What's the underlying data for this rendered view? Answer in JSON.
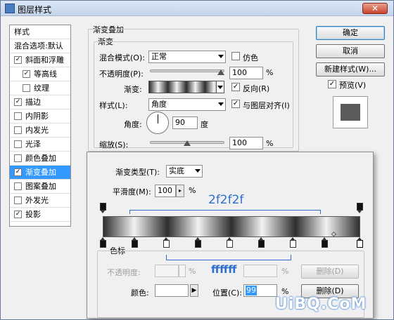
{
  "window": {
    "title": "图层样式",
    "close": "✕"
  },
  "left_panel": {
    "items": [
      {
        "label": "样式",
        "checkbox": false,
        "checked": false,
        "indent": 0,
        "selected": false
      },
      {
        "label": "混合选项:默认",
        "checkbox": false,
        "checked": false,
        "indent": 0,
        "selected": false
      },
      {
        "label": "斜面和浮雕",
        "checkbox": true,
        "checked": true,
        "indent": 0,
        "selected": false
      },
      {
        "label": "等高线",
        "checkbox": true,
        "checked": true,
        "indent": 1,
        "selected": false
      },
      {
        "label": "纹理",
        "checkbox": true,
        "checked": false,
        "indent": 1,
        "selected": false
      },
      {
        "label": "描边",
        "checkbox": true,
        "checked": true,
        "indent": 0,
        "selected": false
      },
      {
        "label": "内阴影",
        "checkbox": true,
        "checked": false,
        "indent": 0,
        "selected": false
      },
      {
        "label": "内发光",
        "checkbox": true,
        "checked": false,
        "indent": 0,
        "selected": false
      },
      {
        "label": "光泽",
        "checkbox": true,
        "checked": false,
        "indent": 0,
        "selected": false
      },
      {
        "label": "颜色叠加",
        "checkbox": true,
        "checked": false,
        "indent": 0,
        "selected": false
      },
      {
        "label": "渐变叠加",
        "checkbox": true,
        "checked": true,
        "indent": 0,
        "selected": true
      },
      {
        "label": "图案叠加",
        "checkbox": true,
        "checked": false,
        "indent": 0,
        "selected": false
      },
      {
        "label": "外发光",
        "checkbox": true,
        "checked": false,
        "indent": 0,
        "selected": false
      },
      {
        "label": "投影",
        "checkbox": true,
        "checked": true,
        "indent": 0,
        "selected": false
      }
    ]
  },
  "gradient_overlay": {
    "section_title": "渐变叠加",
    "sub_title": "渐变",
    "blend_mode_label": "混合模式(O):",
    "blend_mode_value": "正常",
    "dither_label": "仿色",
    "dither_checked": false,
    "opacity_label": "不透明度(P):",
    "opacity_value": "100",
    "opacity_unit": "%",
    "opacity_level": 1.0,
    "gradient_label": "渐变:",
    "reverse_label": "反向(R)",
    "reverse_checked": true,
    "style_label": "样式(L):",
    "style_value": "角度",
    "align_label": "与图层对齐(I)",
    "align_checked": true,
    "angle_label": "角度:",
    "angle_value": "90",
    "angle_unit": "度",
    "scale_label": "缩放(S):",
    "scale_value": "100",
    "scale_unit": "%",
    "scale_level": 0.5
  },
  "buttons": {
    "ok": "确定",
    "cancel": "取消",
    "new_style": "新建样式(W)...",
    "preview_label": "预览(V)",
    "preview_checked": true
  },
  "editor": {
    "gradient_type_label": "渐变类型(T):",
    "gradient_type_value": "实底",
    "smoothness_label": "平滑度(M):",
    "smoothness_value": "100",
    "smoothness_unit": "%",
    "annotation_top": "2f2f2f",
    "annotation_bottom": "ffffff",
    "stops_title": "色标",
    "opacity_label": "不透明度:",
    "opacity_unit": "%",
    "location_unit_top": "%",
    "delete_top": "删除(D)",
    "color_label": "颜色:",
    "location_label": "位置(C):",
    "location_value": "99",
    "location_unit": "%",
    "delete_bottom": "删除(D)"
  },
  "watermark": "UiBQ.CoM"
}
